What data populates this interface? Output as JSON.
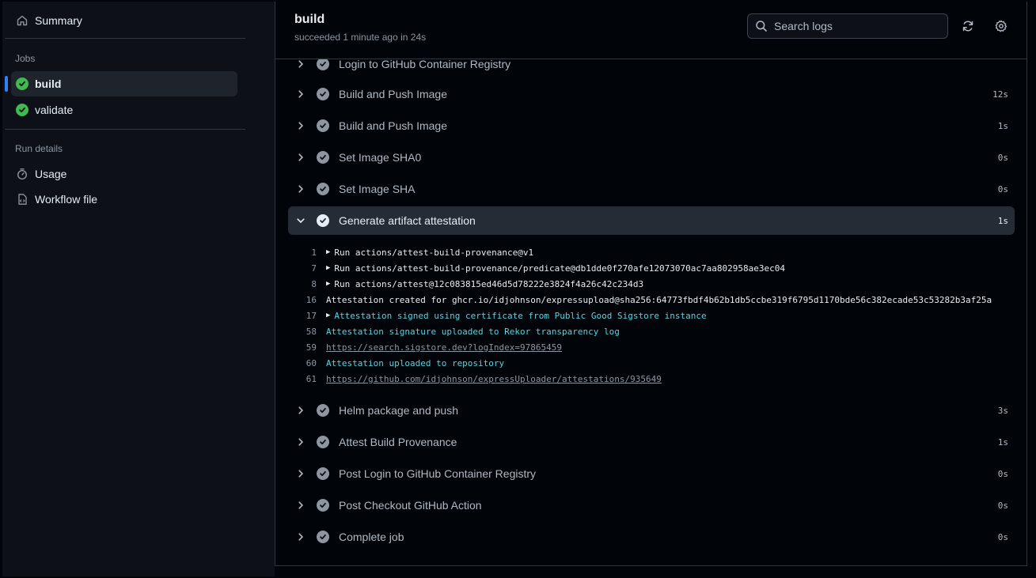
{
  "sidebar": {
    "summary": {
      "label": "Summary",
      "icon": "home-icon"
    },
    "jobs_heading": "Jobs",
    "jobs": [
      {
        "label": "build",
        "status": "success",
        "active": true
      },
      {
        "label": "validate",
        "status": "success",
        "active": false
      }
    ],
    "run_details_heading": "Run details",
    "details": [
      {
        "label": "Usage",
        "icon": "stopwatch-icon"
      },
      {
        "label": "Workflow file",
        "icon": "file-code-icon"
      }
    ]
  },
  "header": {
    "title": "build",
    "subtitle": "succeeded 1 minute ago in 24s",
    "search_placeholder": "Search logs"
  },
  "steps": {
    "partial": {
      "label": "Login to GitHub Container Registry"
    },
    "before": [
      {
        "label": "Build and Push Image",
        "duration": "12s"
      },
      {
        "label": "Build and Push Image",
        "duration": "1s"
      },
      {
        "label": "Set Image SHA0",
        "duration": "0s"
      },
      {
        "label": "Set Image SHA",
        "duration": "0s"
      }
    ],
    "expanded": {
      "label": "Generate artifact attestation",
      "duration": "1s"
    },
    "logs": [
      {
        "ln": "1",
        "text": "Run actions/attest-build-provenance@v1",
        "collapsible": true,
        "style": "plain"
      },
      {
        "ln": "7",
        "text": "Run actions/attest-build-provenance/predicate@db1dde0f270afe12073070ac7aa802958ae3ec04",
        "collapsible": true,
        "style": "plain"
      },
      {
        "ln": "8",
        "text": "Run actions/attest@12c083815ed46d5d78222e3824f4a26c42c234d3",
        "collapsible": true,
        "style": "plain"
      },
      {
        "ln": "16",
        "text": "Attestation created for ghcr.io/idjohnson/expressupload@sha256:64773fbdf4b62b1db5ccbe319f6795d1170bde56c382ecade53c53282b3af25a",
        "collapsible": false,
        "style": "plain"
      },
      {
        "ln": "17",
        "text": "Attestation signed using certificate from Public Good Sigstore instance",
        "collapsible": true,
        "style": "cyan"
      },
      {
        "ln": "58",
        "text": "Attestation signature uploaded to Rekor transparency log",
        "collapsible": false,
        "style": "cyan"
      },
      {
        "ln": "59",
        "text": "https://search.sigstore.dev?logIndex=97865459",
        "collapsible": false,
        "style": "link"
      },
      {
        "ln": "60",
        "text": "Attestation uploaded to repository",
        "collapsible": false,
        "style": "cyan"
      },
      {
        "ln": "61",
        "text": "https://github.com/idjohnson/expressUploader/attestations/935649",
        "collapsible": false,
        "style": "link"
      }
    ],
    "after": [
      {
        "label": "Helm package and push",
        "duration": "3s"
      },
      {
        "label": "Attest Build Provenance",
        "duration": "1s"
      },
      {
        "label": "Post Login to GitHub Container Registry",
        "duration": "0s"
      },
      {
        "label": "Post Checkout GitHub Action",
        "duration": "0s"
      },
      {
        "label": "Complete job",
        "duration": "0s"
      }
    ]
  },
  "colors": {
    "success": "#3fb950",
    "accent": "#2f81f7",
    "log_highlight": "#56d4dd",
    "step_check": "#8d96a0"
  }
}
